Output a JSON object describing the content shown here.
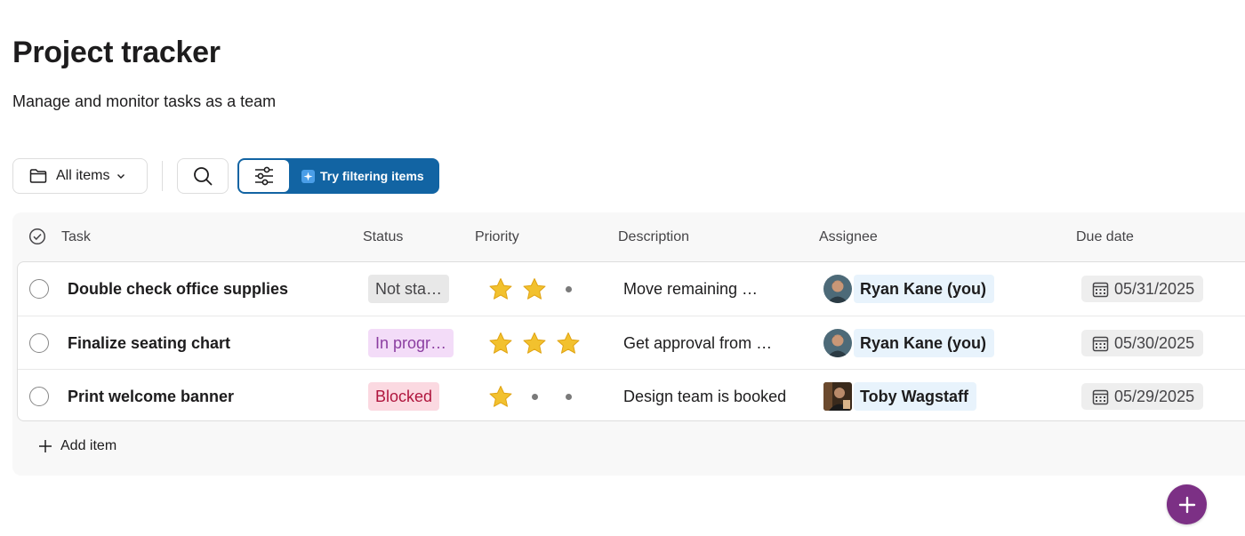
{
  "header": {
    "title": "Project tracker",
    "subtitle": "Manage and monitor tasks as a team"
  },
  "toolbar": {
    "view_label": "All items",
    "filter_hint": "Try filtering items"
  },
  "table": {
    "columns": [
      "Task",
      "Status",
      "Priority",
      "Description",
      "Assignee",
      "Due date"
    ],
    "rows": [
      {
        "task": "Double check office supplies",
        "status": "Not sta…",
        "status_bg": "#e8e8e8",
        "status_color": "#454447",
        "priority": 2,
        "description": "Move remaining …",
        "assignee": "Ryan Kane (you)",
        "due_date": "05/31/2025"
      },
      {
        "task": "Finalize seating chart",
        "status": "In progr…",
        "status_bg": "#f3dcf8",
        "status_color": "#8b3ea1",
        "priority": 3,
        "description": "Get approval from …",
        "assignee": "Ryan Kane (you)",
        "due_date": "05/30/2025"
      },
      {
        "task": "Print welcome banner",
        "status": "Blocked",
        "status_bg": "#fbd9e1",
        "status_color": "#b0163e",
        "priority": 1,
        "description": "Design team is booked",
        "assignee": "Toby Wagstaff",
        "due_date": "05/29/2025"
      }
    ],
    "add_item_label": "Add item"
  },
  "colors": {
    "accent": "#1264a3",
    "fab": "#7c3085",
    "assignee_chip": "#e8f3fc",
    "star": "#f2c12e"
  },
  "icons": [
    "folder-icon",
    "chevron-down-icon",
    "search-icon",
    "sliders-icon",
    "sparkle-icon",
    "check-circle-icon",
    "star-icon",
    "calendar-icon",
    "plus-icon"
  ]
}
